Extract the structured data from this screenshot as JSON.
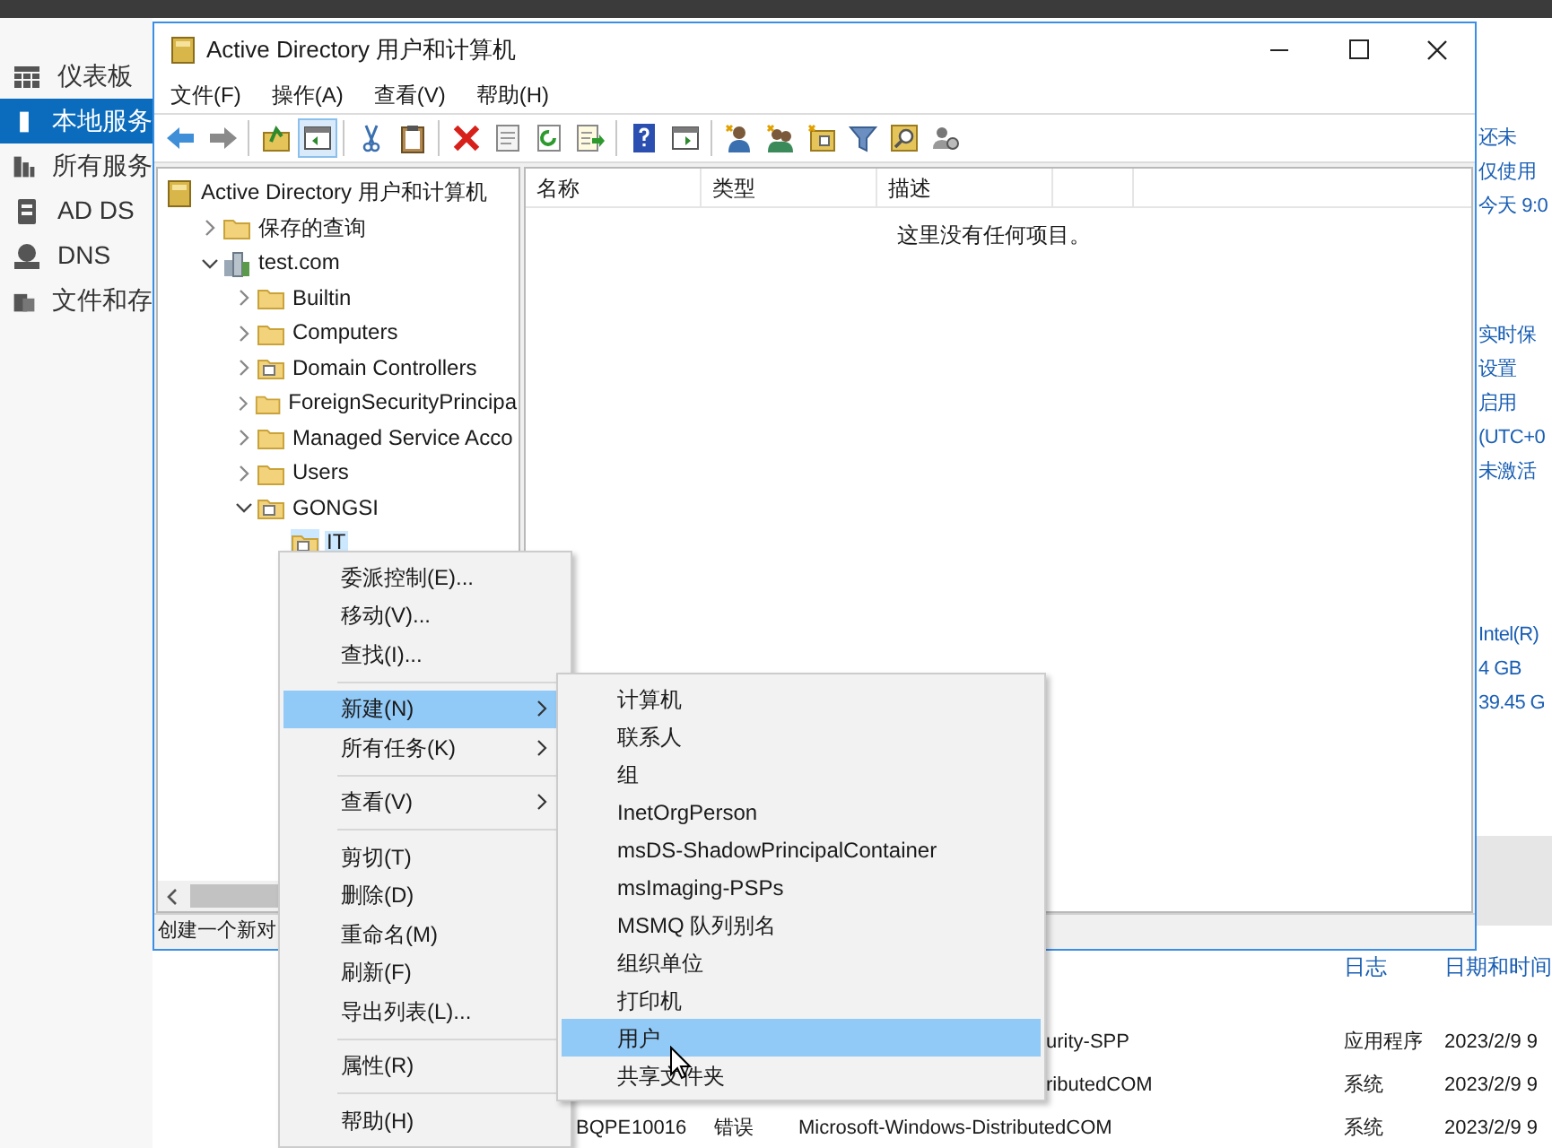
{
  "sidebar": [
    {
      "label": "仪表板",
      "kind": "dashboard",
      "selected": false
    },
    {
      "label": "本地服务",
      "kind": "server",
      "selected": true
    },
    {
      "label": "所有服务",
      "kind": "servers",
      "selected": false
    },
    {
      "label": "AD DS",
      "kind": "adds",
      "selected": false
    },
    {
      "label": "DNS",
      "kind": "dns",
      "selected": false
    },
    {
      "label": "文件和存",
      "kind": "files",
      "selected": false
    }
  ],
  "details": [
    {
      "values": [
        "还未",
        "仅使用",
        "今天 9:0"
      ]
    },
    {
      "values": [
        "实时保",
        "设置",
        "启用",
        "(UTC+0",
        "未激活"
      ]
    },
    {
      "values": [
        "Intel(R)",
        "4 GB",
        "39.45 G"
      ]
    }
  ],
  "events": {
    "columns": [
      "日志",
      "日期和时间"
    ],
    "rows": [
      {
        "source": "urity-SPP",
        "log": "应用程序",
        "date": "2023/2/9 9"
      },
      {
        "source": "ributedCOM",
        "log": "系统",
        "date": "2023/2/9 9"
      },
      {
        "computer": "BQPE",
        "id": "10016",
        "level": "错误",
        "source": "Microsoft-Windows-DistributedCOM",
        "log": "系统",
        "date": "2023/2/9 9"
      }
    ]
  },
  "window": {
    "title": "Active Directory 用户和计算机",
    "menu": [
      "文件(F)",
      "操作(A)",
      "查看(V)",
      "帮助(H)"
    ],
    "toolbar": [
      {
        "kind": "back",
        "pressed": false
      },
      {
        "kind": "forward",
        "pressed": false
      },
      {
        "kind": "separator"
      },
      {
        "kind": "up",
        "pressed": false
      },
      {
        "kind": "tree",
        "pressed": true
      },
      {
        "kind": "separator"
      },
      {
        "kind": "cut",
        "pressed": false
      },
      {
        "kind": "paste",
        "pressed": false
      },
      {
        "kind": "separator"
      },
      {
        "kind": "delete",
        "pressed": false
      },
      {
        "kind": "properties",
        "pressed": false
      },
      {
        "kind": "refresh",
        "pressed": false
      },
      {
        "kind": "export",
        "pressed": false
      },
      {
        "kind": "separator"
      },
      {
        "kind": "help",
        "pressed": false
      },
      {
        "kind": "console",
        "pressed": false
      },
      {
        "kind": "separator"
      },
      {
        "kind": "user",
        "pressed": false
      },
      {
        "kind": "group",
        "pressed": false
      },
      {
        "kind": "ou",
        "pressed": false
      },
      {
        "kind": "filter",
        "pressed": false
      },
      {
        "kind": "find",
        "pressed": false
      },
      {
        "kind": "delegate",
        "pressed": false
      }
    ],
    "tree": [
      {
        "label": "Active Directory 用户和计算机",
        "kind": "root",
        "selected": false,
        "children": [
          {
            "label": "保存的查询",
            "kind": "folder",
            "expanded": false,
            "selected": false
          },
          {
            "label": "test.com",
            "kind": "domain",
            "expanded": true,
            "selected": false,
            "children": [
              {
                "label": "Builtin",
                "kind": "folder",
                "expanded": false,
                "selected": false
              },
              {
                "label": "Computers",
                "kind": "folder",
                "expanded": false,
                "selected": false
              },
              {
                "label": "Domain Controllers",
                "kind": "ou",
                "expanded": false,
                "selected": false
              },
              {
                "label": "ForeignSecurityPrincipa",
                "kind": "folder",
                "expanded": false,
                "selected": false
              },
              {
                "label": "Managed Service Acco",
                "kind": "folder",
                "expanded": false,
                "selected": false
              },
              {
                "label": "Users",
                "kind": "folder",
                "expanded": false,
                "selected": false
              },
              {
                "label": "GONGSI",
                "kind": "ou",
                "expanded": true,
                "selected": false,
                "children": [
                  {
                    "label": "IT",
                    "kind": "ou",
                    "selected": true
                  }
                ]
              }
            ]
          }
        ]
      }
    ],
    "list": {
      "columns": [
        "名称",
        "类型",
        "描述"
      ],
      "empty_message": "这里没有任何项目。"
    },
    "status": "创建一个新对"
  },
  "context_menu": {
    "items": [
      {
        "kind": "item",
        "label": "委派控制(E)...",
        "submenu": false,
        "selected": false
      },
      {
        "kind": "item",
        "label": "移动(V)...",
        "submenu": false,
        "selected": false
      },
      {
        "kind": "item",
        "label": "查找(I)...",
        "submenu": false,
        "selected": false
      },
      {
        "kind": "separator"
      },
      {
        "kind": "item",
        "label": "新建(N)",
        "submenu": true,
        "selected": true
      },
      {
        "kind": "item",
        "label": "所有任务(K)",
        "submenu": true,
        "selected": false
      },
      {
        "kind": "separator"
      },
      {
        "kind": "item",
        "label": "查看(V)",
        "submenu": true,
        "selected": false
      },
      {
        "kind": "separator"
      },
      {
        "kind": "item",
        "label": "剪切(T)",
        "submenu": false,
        "selected": false
      },
      {
        "kind": "item",
        "label": "删除(D)",
        "submenu": false,
        "selected": false
      },
      {
        "kind": "item",
        "label": "重命名(M)",
        "submenu": false,
        "selected": false
      },
      {
        "kind": "item",
        "label": "刷新(F)",
        "submenu": false,
        "selected": false
      },
      {
        "kind": "item",
        "label": "导出列表(L)...",
        "submenu": false,
        "selected": false
      },
      {
        "kind": "separator"
      },
      {
        "kind": "item",
        "label": "属性(R)",
        "submenu": false,
        "selected": false
      },
      {
        "kind": "separator"
      },
      {
        "kind": "item",
        "label": "帮助(H)",
        "submenu": false,
        "selected": false
      }
    ]
  },
  "submenu": {
    "items": [
      {
        "label": "计算机",
        "selected": false
      },
      {
        "label": "联系人",
        "selected": false
      },
      {
        "label": "组",
        "selected": false
      },
      {
        "label": "InetOrgPerson",
        "selected": false
      },
      {
        "label": "msDS-ShadowPrincipalContainer",
        "selected": false
      },
      {
        "label": "msImaging-PSPs",
        "selected": false
      },
      {
        "label": "MSMQ 队列别名",
        "selected": false
      },
      {
        "label": "组织单位",
        "selected": false
      },
      {
        "label": "打印机",
        "selected": false
      },
      {
        "label": "用户",
        "selected": true
      },
      {
        "label": "共享文件夹",
        "selected": false
      }
    ]
  }
}
